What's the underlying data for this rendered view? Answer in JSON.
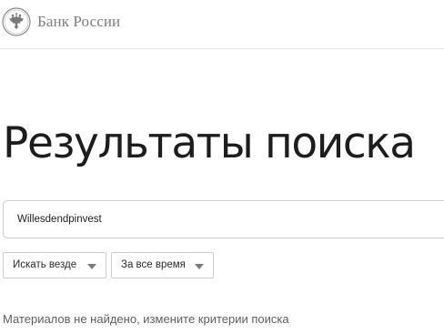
{
  "header": {
    "logo_text": "Банк России",
    "emblem_icon": "double-headed-eagle-icon"
  },
  "page": {
    "title": "Результаты поиска"
  },
  "search": {
    "query": "Willesdendpinvest"
  },
  "filters": {
    "scope_label": "Искать везде",
    "period_label": "За все время"
  },
  "results": {
    "empty_message": "Материалов не найдено, измените критерии поиска"
  },
  "colors": {
    "text": "#1d1d1d",
    "muted": "#7e7e7e",
    "border": "#cfcfcf"
  }
}
